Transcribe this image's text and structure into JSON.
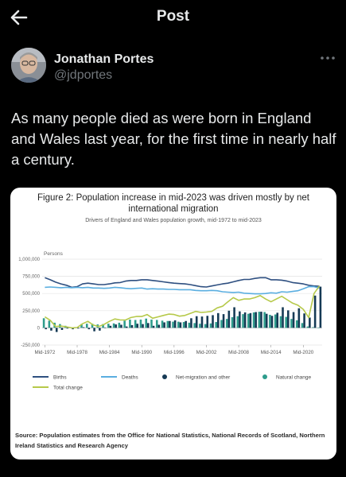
{
  "header": {
    "title": "Post",
    "back_icon": "arrow-left-icon"
  },
  "author": {
    "name": "Jonathan Portes",
    "handle": "@jdportes"
  },
  "tweet": {
    "text": "As many people died as were born in England and Wales last year, for the first time in nearly half a century."
  },
  "card": {
    "source": "Source: Population estimates from the Office for National Statistics, National Records of Scotland, Northern Ireland Statistics and Research Agency"
  },
  "chart_data": {
    "type": "line",
    "title": "Figure 2: Population increase in mid-2023 was driven mostly by net international migration",
    "subtitle": "Drivers of England and Wales population growth, mid-1972 to mid-2023",
    "ylabel": "Persons",
    "ylim": [
      -250000,
      1000000
    ],
    "yticks": [
      "1,000,000",
      "750,000",
      "500,000",
      "250,000",
      "0",
      "-250,000"
    ],
    "ytick_values": [
      1000000,
      750000,
      500000,
      250000,
      0,
      -250000
    ],
    "xticks": [
      "Mid-1972",
      "Mid-1978",
      "Mid-1984",
      "Mid-1990",
      "Mid-1996",
      "Mid-2002",
      "Mid-2008",
      "Mid-2014",
      "Mid-2020"
    ],
    "xtick_years": [
      1972,
      1978,
      1984,
      1990,
      1996,
      2002,
      2008,
      2014,
      2020
    ],
    "x_start": 1972,
    "x_end": 2023,
    "grid": true,
    "legend_position": "bottom",
    "colors": {
      "births": "#2e4f80",
      "deaths": "#5aaee0",
      "net_migration": "#163a55",
      "natural_change": "#2e9c8c",
      "total_change": "#b6c94a"
    },
    "series": [
      {
        "name": "Births",
        "key": "births",
        "kind": "line",
        "values": [
          730000,
          700000,
          665000,
          640000,
          620000,
          590000,
          600000,
          640000,
          650000,
          640000,
          630000,
          630000,
          640000,
          655000,
          660000,
          680000,
          690000,
          690000,
          700000,
          700000,
          690000,
          680000,
          670000,
          660000,
          650000,
          645000,
          640000,
          630000,
          615000,
          600000,
          595000,
          610000,
          625000,
          640000,
          650000,
          670000,
          690000,
          705000,
          705000,
          720000,
          730000,
          730000,
          700000,
          700000,
          695000,
          680000,
          660000,
          650000,
          640000,
          620000,
          610000,
          605000
        ]
      },
      {
        "name": "Deaths",
        "key": "deaths",
        "kind": "line",
        "values": [
          590000,
          595000,
          590000,
          585000,
          590000,
          585000,
          590000,
          585000,
          590000,
          580000,
          580000,
          575000,
          580000,
          590000,
          585000,
          575000,
          570000,
          575000,
          580000,
          565000,
          570000,
          565000,
          565000,
          560000,
          560000,
          555000,
          555000,
          555000,
          545000,
          540000,
          540000,
          545000,
          540000,
          525000,
          520000,
          515000,
          520000,
          505000,
          500000,
          495000,
          495000,
          500000,
          510000,
          505000,
          525000,
          520000,
          530000,
          540000,
          570000,
          600000,
          600000,
          580000
        ]
      },
      {
        "name": "Net-migration and other",
        "key": "net_migration",
        "kind": "bar",
        "values": [
          -20000,
          -40000,
          -60000,
          -30000,
          -10000,
          -20000,
          -10000,
          10000,
          -20000,
          -50000,
          -40000,
          5000,
          30000,
          50000,
          45000,
          20000,
          40000,
          60000,
          55000,
          70000,
          30000,
          45000,
          80000,
          100000,
          110000,
          80000,
          100000,
          140000,
          170000,
          165000,
          175000,
          185000,
          215000,
          200000,
          250000,
          300000,
          240000,
          225000,
          215000,
          230000,
          235000,
          205000,
          175000,
          220000,
          300000,
          255000,
          230000,
          285000,
          210000,
          150000,
          470000,
          600000
        ]
      },
      {
        "name": "Natural change",
        "key": "natural_change",
        "kind": "bar",
        "values": [
          140000,
          105000,
          75000,
          55000,
          30000,
          5000,
          10000,
          55000,
          60000,
          60000,
          50000,
          55000,
          60000,
          65000,
          75000,
          105000,
          120000,
          115000,
          120000,
          135000,
          120000,
          115000,
          105000,
          100000,
          90000,
          90000,
          85000,
          75000,
          70000,
          60000,
          55000,
          65000,
          85000,
          115000,
          130000,
          155000,
          170000,
          200000,
          205000,
          225000,
          235000,
          230000,
          190000,
          195000,
          170000,
          160000,
          130000,
          110000,
          70000,
          20000,
          10000,
          5000
        ]
      },
      {
        "name": "Total change",
        "key": "total_change",
        "kind": "line",
        "values": [
          160000,
          110000,
          20000,
          25000,
          15000,
          0,
          5000,
          60000,
          95000,
          40000,
          20000,
          50000,
          95000,
          130000,
          115000,
          115000,
          150000,
          165000,
          165000,
          195000,
          140000,
          160000,
          180000,
          200000,
          195000,
          170000,
          180000,
          210000,
          240000,
          225000,
          230000,
          240000,
          290000,
          315000,
          380000,
          440000,
          400000,
          420000,
          420000,
          440000,
          470000,
          420000,
          380000,
          420000,
          460000,
          410000,
          360000,
          330000,
          270000,
          150000,
          500000,
          610000
        ]
      }
    ]
  }
}
